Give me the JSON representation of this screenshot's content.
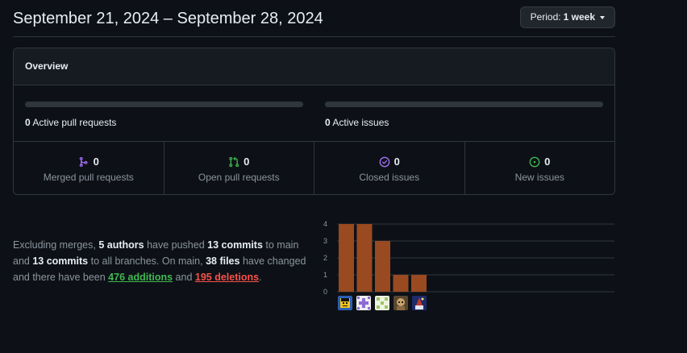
{
  "header": {
    "date_range": "September 21, 2024 – September 28, 2024",
    "period_label": "Period:",
    "period_value": "1 week"
  },
  "overview": {
    "title": "Overview",
    "active_prs_count": "0",
    "active_prs_label": "Active pull requests",
    "active_issues_count": "0",
    "active_issues_label": "Active issues",
    "stats": [
      {
        "count": "0",
        "label": "Merged pull requests",
        "icon": "merge-icon",
        "color": "#a371f7"
      },
      {
        "count": "0",
        "label": "Open pull requests",
        "icon": "pull-request-icon",
        "color": "#3fb950"
      },
      {
        "count": "0",
        "label": "Closed issues",
        "icon": "issue-closed-icon",
        "color": "#a371f7"
      },
      {
        "count": "0",
        "label": "New issues",
        "icon": "issue-opened-icon",
        "color": "#3fb950"
      }
    ]
  },
  "summary": {
    "p1": "Excluding merges,",
    "authors": "5 authors",
    "p2": "have pushed",
    "commits_main": "13 commits",
    "p3": "to main and",
    "commits_all": "13 commits",
    "p4": "to all branches. On main,",
    "files": "38 files",
    "p5": "have changed and there have been",
    "additions": "476 additions",
    "p6": "and",
    "deletions": "195 deletions",
    "p7": "."
  },
  "chart_data": {
    "type": "bar",
    "categories": [
      "author-1",
      "author-2",
      "author-3",
      "author-4",
      "author-5"
    ],
    "values": [
      4,
      4,
      3,
      1,
      1
    ],
    "ylim": [
      0,
      4
    ],
    "yticks": [
      "0",
      "1",
      "2",
      "3",
      "4"
    ],
    "bar_color": "#9a4a20",
    "grid": true
  },
  "colors": {
    "background": "#0d1117",
    "border": "#30363d",
    "additions": "#3fb950",
    "deletions": "#f85149"
  }
}
